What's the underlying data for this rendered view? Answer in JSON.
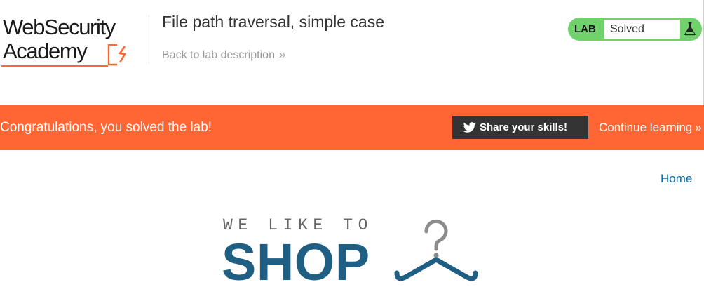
{
  "header": {
    "logo": {
      "line1": "WebSecurity",
      "line2": "Academy"
    },
    "lab_title": "File path traversal, simple case",
    "back_link": "Back to lab description",
    "back_link_chevron": "»"
  },
  "lab_status": {
    "tag": "LAB",
    "state": "Solved",
    "icon": "flask-icon",
    "color": "#70d16d"
  },
  "banner": {
    "message": "Congratulations, you solved the lab!",
    "share_button": "Share your skills!",
    "share_icon": "twitter-icon",
    "continue_link": "Continue learning",
    "continue_chevron": "»",
    "color": "#ff6633"
  },
  "nav": {
    "home": "Home"
  },
  "shop_logo": {
    "tagline": "WE LIKE TO",
    "word": "SHOP",
    "icon": "hanger-icon",
    "color": "#1f5f84"
  }
}
